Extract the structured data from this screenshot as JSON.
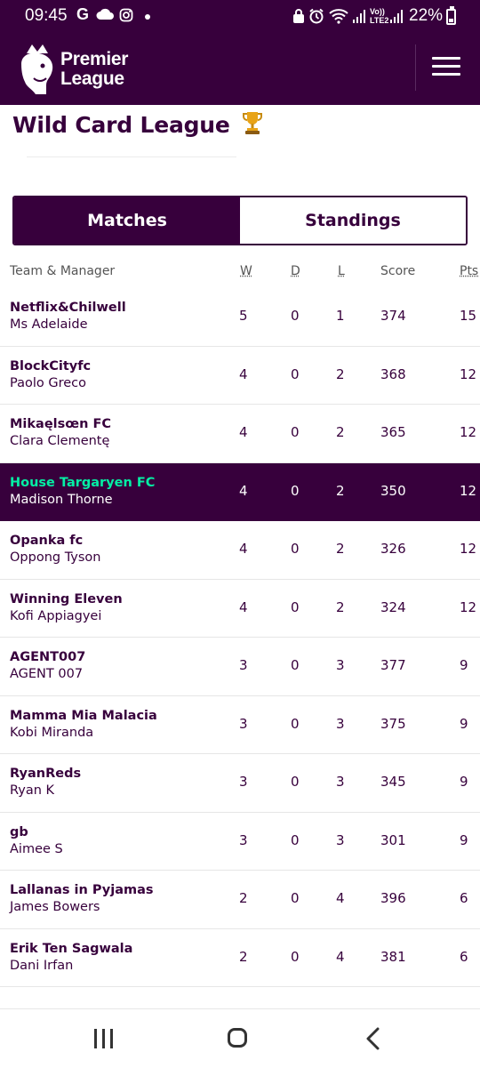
{
  "status_bar": {
    "time": "09:45",
    "battery_percent": "22%",
    "left_icons": [
      "google-icon",
      "cloud-icon",
      "instagram-icon",
      "dot-icon"
    ],
    "right_icons": [
      "lock-icon",
      "alarm-icon",
      "wifi-icon",
      "signal-icon",
      "volte-icon",
      "signal-icon"
    ],
    "volte_label_1": "Vo))",
    "volte_label_2": "LTE2"
  },
  "header": {
    "logo_line1": "Premier",
    "logo_line2": "League",
    "menu_icon": "hamburger-menu-icon",
    "background_color": "#37003c"
  },
  "league": {
    "title": "Wild Card League",
    "title_icon": "trophy-icon"
  },
  "tabs": [
    {
      "label": "Matches",
      "active": true
    },
    {
      "label": "Standings",
      "active": false
    }
  ],
  "table": {
    "headers": {
      "team_manager": "Team & Manager",
      "w": "W",
      "d": "D",
      "l": "L",
      "score": "Score",
      "pts": "Pts"
    },
    "rows": [
      {
        "team": "Netflix&Chilwell",
        "manager": "Ms Adelaide",
        "w": "5",
        "d": "0",
        "l": "1",
        "score": "374",
        "pts": "15",
        "highlight": false
      },
      {
        "team": "BlockCityfc",
        "manager": "Paolo Greco",
        "w": "4",
        "d": "0",
        "l": "2",
        "score": "368",
        "pts": "12",
        "highlight": false
      },
      {
        "team": "Mikaęlsœn FC",
        "manager": "Clara Clementę",
        "w": "4",
        "d": "0",
        "l": "2",
        "score": "365",
        "pts": "12",
        "highlight": false
      },
      {
        "team": "House Targaryen FC",
        "manager": "Madison Thorne",
        "w": "4",
        "d": "0",
        "l": "2",
        "score": "350",
        "pts": "12",
        "highlight": true
      },
      {
        "team": "Opanka fc",
        "manager": "Oppong Tyson",
        "w": "4",
        "d": "0",
        "l": "2",
        "score": "326",
        "pts": "12",
        "highlight": false
      },
      {
        "team": "Winning Eleven",
        "manager": "Kofi Appiagyei",
        "w": "4",
        "d": "0",
        "l": "2",
        "score": "324",
        "pts": "12",
        "highlight": false
      },
      {
        "team": "AGENT007",
        "manager": "AGENT 007",
        "w": "3",
        "d": "0",
        "l": "3",
        "score": "377",
        "pts": "9",
        "highlight": false
      },
      {
        "team": "Mamma Mia Malacia",
        "manager": "Kobi Miranda",
        "w": "3",
        "d": "0",
        "l": "3",
        "score": "375",
        "pts": "9",
        "highlight": false
      },
      {
        "team": "RyanReds",
        "manager": "Ryan K",
        "w": "3",
        "d": "0",
        "l": "3",
        "score": "345",
        "pts": "9",
        "highlight": false
      },
      {
        "team": "gb",
        "manager": "Aimee S",
        "w": "3",
        "d": "0",
        "l": "3",
        "score": "301",
        "pts": "9",
        "highlight": false
      },
      {
        "team": "Lallanas in Pyjamas",
        "manager": "James Bowers",
        "w": "2",
        "d": "0",
        "l": "4",
        "score": "396",
        "pts": "6",
        "highlight": false
      },
      {
        "team": "Erik Ten Sagwala",
        "manager": "Dani Irfan",
        "w": "2",
        "d": "0",
        "l": "4",
        "score": "381",
        "pts": "6",
        "highlight": false
      }
    ]
  },
  "colors": {
    "primary": "#37003c",
    "highlight_text": "#05f0a5"
  },
  "nav_bar": {
    "icons": [
      "recents-icon",
      "home-icon",
      "back-icon"
    ]
  }
}
